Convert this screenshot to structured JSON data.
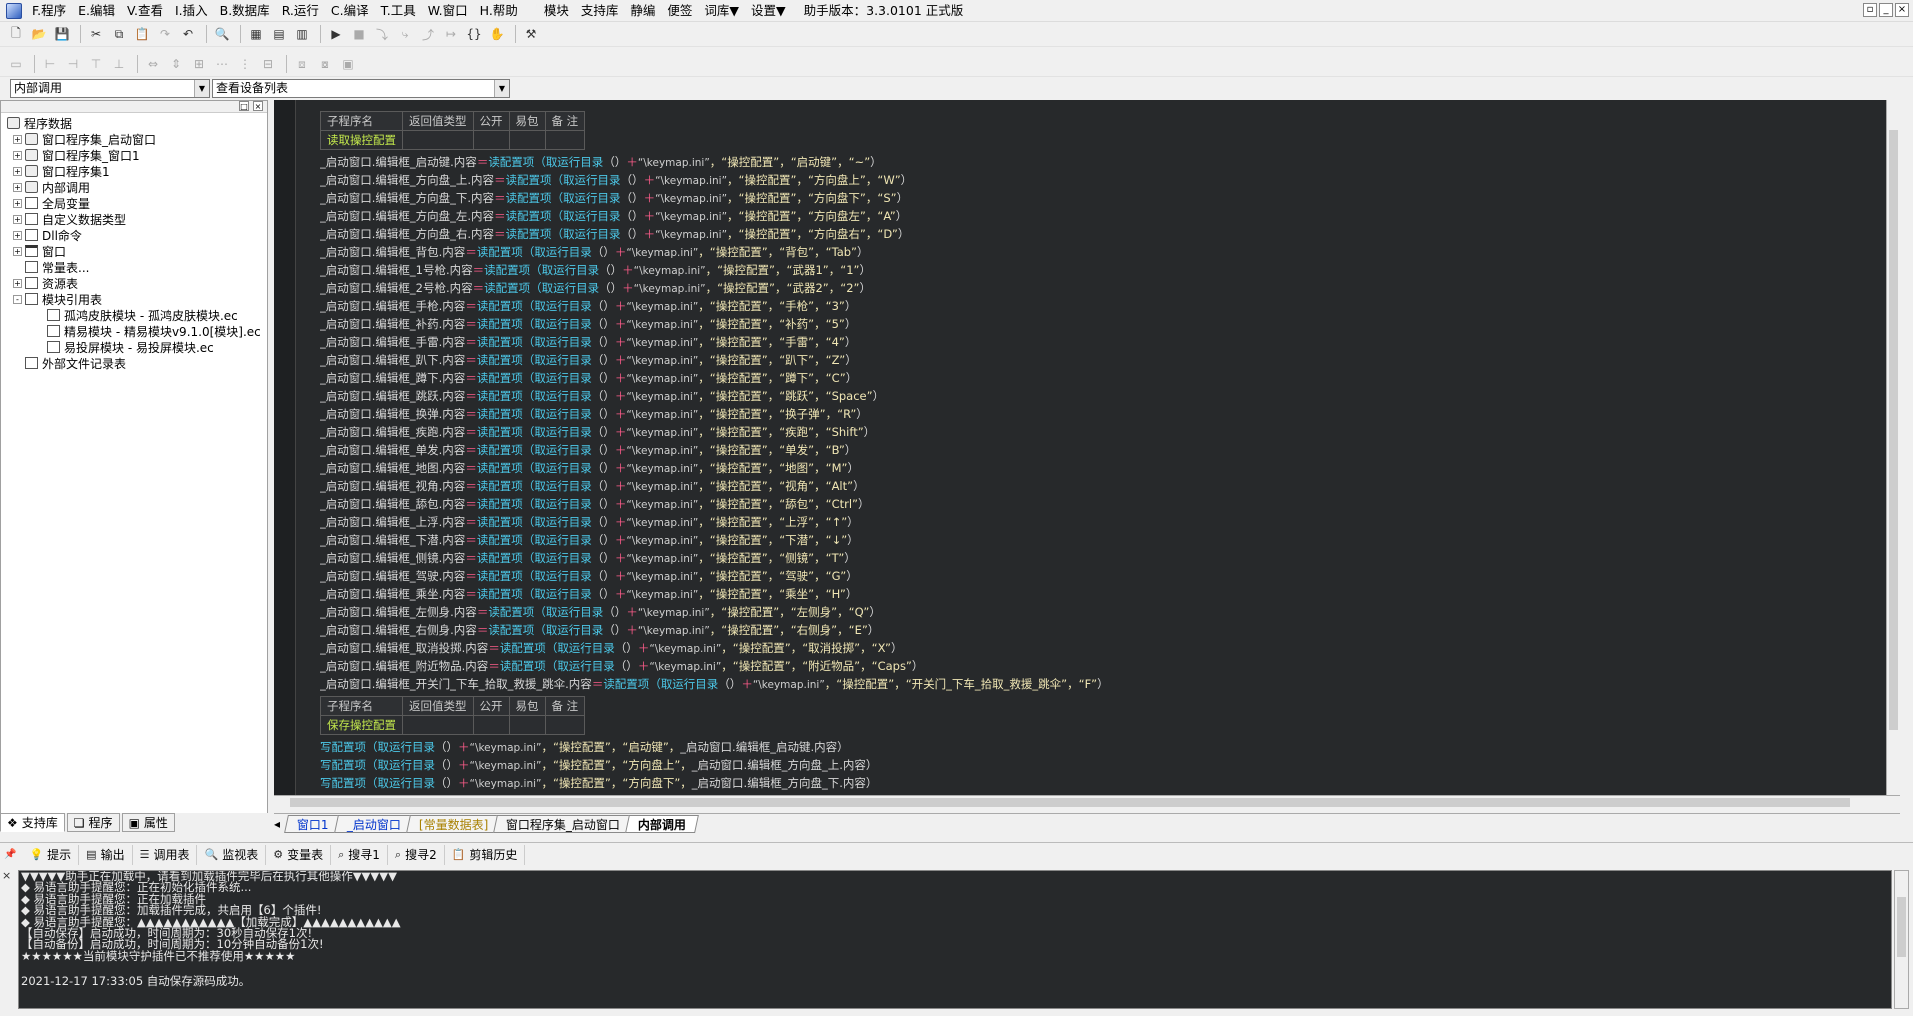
{
  "menu": {
    "items": [
      "F.程序",
      "E.编辑",
      "V.查看",
      "I.插入",
      "B.数据库",
      "R.运行",
      "C.编译",
      "T.工具",
      "W.窗口",
      "H.帮助"
    ],
    "extra": [
      "模块",
      "支持库",
      "静编",
      "便签",
      "词库▼",
      "设置▼"
    ],
    "version": "助手版本：3.3.0101 正式版"
  },
  "combos": {
    "left": "内部调用",
    "right": "查看设备列表"
  },
  "tree": {
    "root": "程序数据",
    "items": [
      {
        "label": "窗口程序集_启动窗口",
        "icon": "assembly-icon",
        "exp": "+"
      },
      {
        "label": "窗口程序集_窗口1",
        "icon": "assembly-icon",
        "exp": "+"
      },
      {
        "label": "窗口程序集1",
        "icon": "assembly-icon",
        "exp": "+"
      },
      {
        "label": "内部调用",
        "icon": "assembly-icon",
        "exp": "+"
      },
      {
        "label": "全局变量",
        "icon": "global-var-icon",
        "exp": "+"
      },
      {
        "label": "自定义数据类型",
        "icon": "datatype-icon",
        "exp": "+"
      },
      {
        "label": "Dll命令",
        "icon": "dll-icon",
        "exp": "+"
      },
      {
        "label": "窗口",
        "icon": "window-icon",
        "exp": "+"
      },
      {
        "label": "常量表...",
        "icon": "constant-icon",
        "exp": ""
      },
      {
        "label": "资源表",
        "icon": "resource-icon",
        "exp": "+"
      },
      {
        "label": "模块引用表",
        "icon": "module-icon",
        "exp": "-"
      },
      {
        "label": "孤鸿皮肤模块 - 孤鸿皮肤模块.ec",
        "icon": "module-file-icon",
        "exp": "",
        "indent": true
      },
      {
        "label": "精易模块 - 精易模块v9.1.0[模块].ec",
        "icon": "module-file-icon",
        "exp": "",
        "indent": true
      },
      {
        "label": "易投屏模块 - 易投屏模块.ec",
        "icon": "module-file-icon",
        "exp": "",
        "indent": true
      },
      {
        "label": "外部文件记录表",
        "icon": "file-record-icon",
        "exp": ""
      }
    ]
  },
  "left_tabs": [
    "支持库",
    "程序",
    "属性"
  ],
  "sub1": {
    "headers": [
      "子程序名",
      "返回值类型",
      "公开",
      "易包",
      "备 注"
    ],
    "name": "读取操控配置"
  },
  "read_lines": [
    {
      "target": "_启动窗口.编辑框_启动键.内容",
      "val": "启动键",
      "def": "~"
    },
    {
      "target": "_启动窗口.编辑框_方向盘_上.内容",
      "val": "方向盘上",
      "def": "W"
    },
    {
      "target": "_启动窗口.编辑框_方向盘_下.内容",
      "val": "方向盘下",
      "def": "S"
    },
    {
      "target": "_启动窗口.编辑框_方向盘_左.内容",
      "val": "方向盘左",
      "def": "A"
    },
    {
      "target": "_启动窗口.编辑框_方向盘_右.内容",
      "val": "方向盘右",
      "def": "D"
    },
    {
      "target": "_启动窗口.编辑框_背包.内容",
      "val": "背包",
      "def": "Tab"
    },
    {
      "target": "_启动窗口.编辑框_1号枪.内容",
      "val": "武器1",
      "def": "1"
    },
    {
      "target": "_启动窗口.编辑框_2号枪.内容",
      "val": "武器2",
      "def": "2"
    },
    {
      "target": "_启动窗口.编辑框_手枪.内容",
      "val": "手枪",
      "def": "3"
    },
    {
      "target": "_启动窗口.编辑框_补药.内容",
      "val": "补药",
      "def": "5"
    },
    {
      "target": "_启动窗口.编辑框_手雷.内容",
      "val": "手雷",
      "def": "4"
    },
    {
      "target": "_启动窗口.编辑框_趴下.内容",
      "val": "趴下",
      "def": "Z"
    },
    {
      "target": "_启动窗口.编辑框_蹲下.内容",
      "val": "蹲下",
      "def": "C"
    },
    {
      "target": "_启动窗口.编辑框_跳跃.内容",
      "val": "跳跃",
      "def": "Space"
    },
    {
      "target": "_启动窗口.编辑框_换弹.内容",
      "val": "换子弹",
      "def": "R"
    },
    {
      "target": "_启动窗口.编辑框_疾跑.内容",
      "val": "疾跑",
      "def": "Shift"
    },
    {
      "target": "_启动窗口.编辑框_单发.内容",
      "val": "单发",
      "def": "B"
    },
    {
      "target": "_启动窗口.编辑框_地图.内容",
      "val": "地图",
      "def": "M"
    },
    {
      "target": "_启动窗口.编辑框_视角.内容",
      "val": "视角",
      "def": "Alt"
    },
    {
      "target": "_启动窗口.编辑框_舔包.内容",
      "val": "舔包",
      "def": "Ctrl"
    },
    {
      "target": "_启动窗口.编辑框_上浮.内容",
      "val": "上浮",
      "def": "↑"
    },
    {
      "target": "_启动窗口.编辑框_下潜.内容",
      "val": "下潜",
      "def": "↓"
    },
    {
      "target": "_启动窗口.编辑框_侧镜.内容",
      "val": "侧镜",
      "def": "T"
    },
    {
      "target": "_启动窗口.编辑框_驾驶.内容",
      "val": "驾驶",
      "def": "G"
    },
    {
      "target": "_启动窗口.编辑框_乘坐.内容",
      "val": "乘坐",
      "def": "H"
    },
    {
      "target": "_启动窗口.编辑框_左侧身.内容",
      "val": "左侧身",
      "def": "Q"
    },
    {
      "target": "_启动窗口.编辑框_右侧身.内容",
      "val": "右侧身",
      "def": "E"
    },
    {
      "target": "_启动窗口.编辑框_取消投掷.内容",
      "val": "取消投掷",
      "def": "X"
    },
    {
      "target": "_启动窗口.编辑框_附近物品.内容",
      "val": "附近物品",
      "def": "Caps"
    },
    {
      "target": "_启动窗口.编辑框_开关门_下车_拾取_救援_跳伞.内容",
      "val": "开关门_下车_拾取_救援_跳伞",
      "def": "F"
    }
  ],
  "code_tokens": {
    "assign": "＝",
    "read_fn": "读配置项",
    "write_fn": "写配置项",
    "dir_fn": "取运行目录",
    "call_open": "（",
    "call_close": "）",
    "empty_args": "（）",
    "plus": "＋",
    "path": "“\\keymap.ini”",
    "section": "“操控配置”",
    "sep": "，"
  },
  "sub2": {
    "headers": [
      "子程序名",
      "返回值类型",
      "公开",
      "易包",
      "备 注"
    ],
    "name": "保存操控配置"
  },
  "write_lines": [
    {
      "key": "启动键",
      "target": "_启动窗口.编辑框_启动键.内容"
    },
    {
      "key": "方向盘上",
      "target": "_启动窗口.编辑框_方向盘_上.内容"
    },
    {
      "key": "方向盘下",
      "target": "_启动窗口.编辑框_方向盘_下.内容"
    }
  ],
  "editor_tabs": [
    {
      "label": "窗口1",
      "style": "blue"
    },
    {
      "label": "_启动窗口",
      "style": "blue"
    },
    {
      "label": "[常量数据表]",
      "style": "gold"
    },
    {
      "label": "窗口程序集_启动窗口",
      "style": "black"
    },
    {
      "label": "内部调用",
      "style": "active"
    }
  ],
  "bottom_tabs": [
    {
      "label": "提示",
      "icon": "hint-icon"
    },
    {
      "label": "输出",
      "icon": "output-icon"
    },
    {
      "label": "调用表",
      "icon": "call-table-icon"
    },
    {
      "label": "监视表",
      "icon": "watch-icon"
    },
    {
      "label": "变量表",
      "icon": "variable-icon"
    },
    {
      "label": "搜寻1",
      "icon": "search1-icon"
    },
    {
      "label": "搜寻2",
      "icon": "search2-icon"
    },
    {
      "label": "剪辑历史",
      "icon": "clip-history-icon"
    }
  ],
  "output": {
    "lines": [
      "▼▼▼▼▼助手正在加载中，请看到加载插件完毕后在执行其他操作▼▼▼▼▼",
      "◆ 易语言助手提醒您：正在初始化插件系统...",
      "◆ 易语言助手提醒您：正在加载插件",
      "◆ 易语言助手提醒您：加载插件完成，共启用【6】个插件!",
      "◆ 易语言助手提醒您：▲▲▲▲▲▲▲▲▲▲▲【加载完成】▲▲▲▲▲▲▲▲▲▲▲",
      "【自动保存】启动成功，时间周期为：30秒自动保存1次!",
      "【自动备份】启动成功，时间周期为：10分钟自动备份1次!",
      "★★★★★★当前模块守护插件已不推荐使用★★★★★"
    ],
    "time_line": "2021-12-17 17:33:05 自动保存源码成功。"
  }
}
